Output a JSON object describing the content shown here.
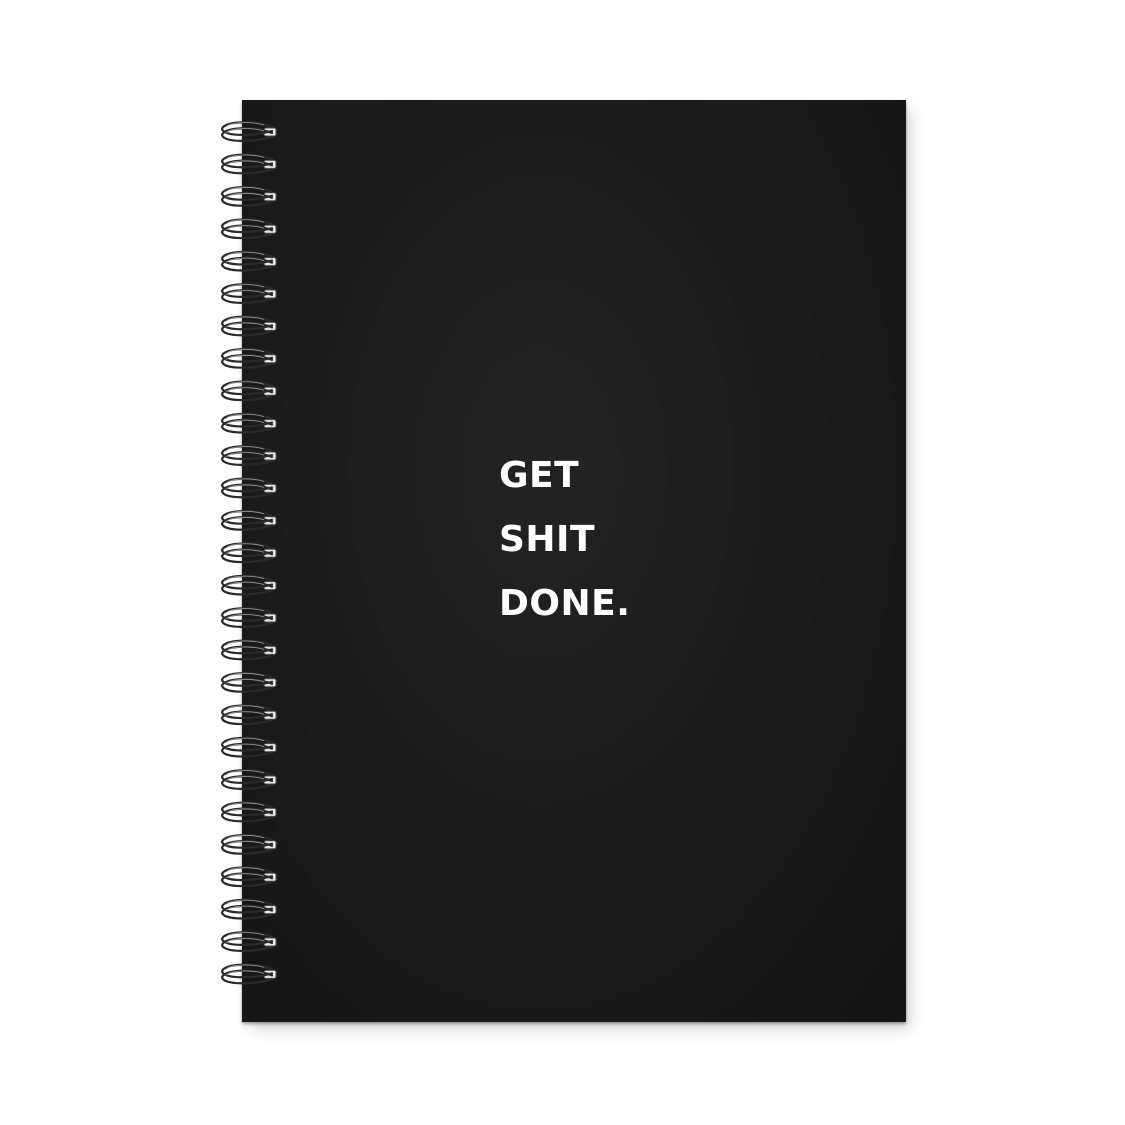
{
  "notebook": {
    "cover_lines": [
      "GET",
      "SHIT",
      "DONE."
    ],
    "cover_color": "#1a1a1a",
    "text_color": "#ffffff",
    "binding": "spiral-wire",
    "spiral_loop_count": 27
  }
}
